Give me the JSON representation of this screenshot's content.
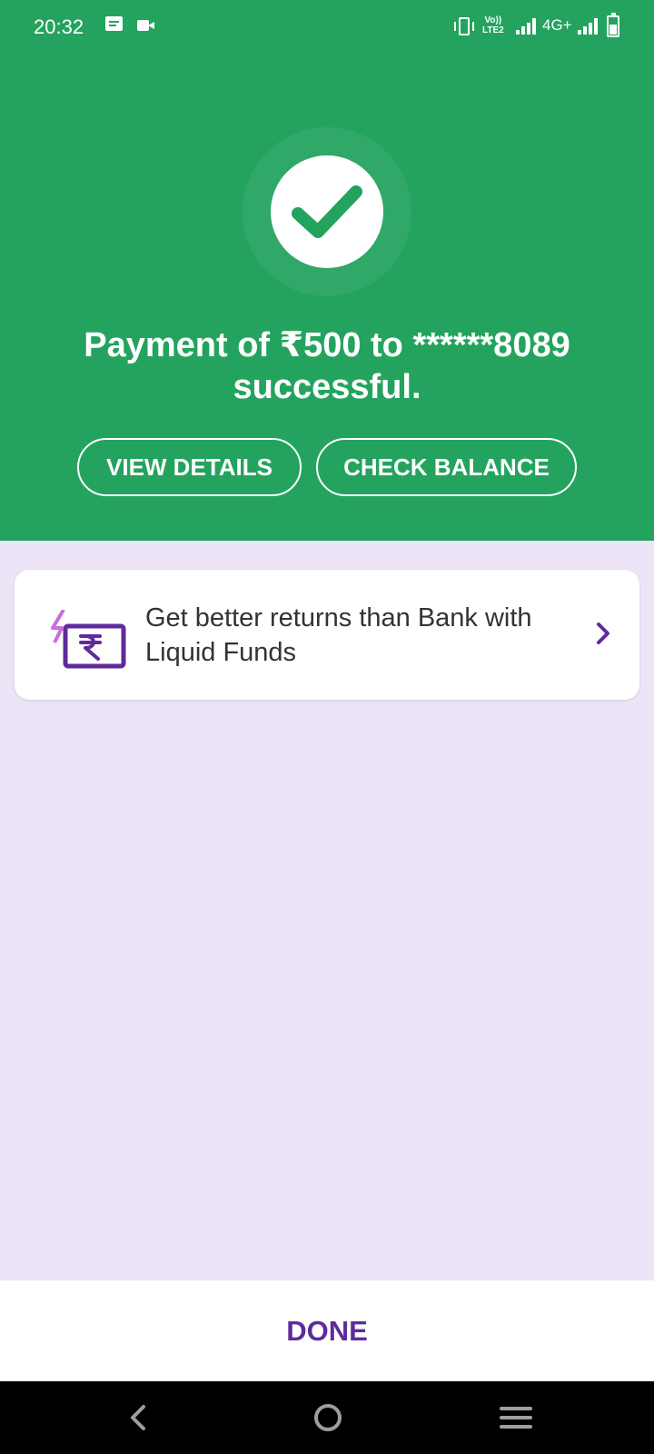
{
  "status_bar": {
    "time": "20:32",
    "volte_top": "Vo))",
    "volte_bottom": "LTE2",
    "network": "4G+",
    "icons": [
      "message-icon",
      "video-icon",
      "vibrate-icon",
      "signal-icon",
      "battery-icon"
    ]
  },
  "header": {
    "icon": "check-icon",
    "title": "Payment of ₹500 to ******8089 successful.",
    "view_details_label": "VIEW DETAILS",
    "check_balance_label": "CHECK BALANCE"
  },
  "promo": {
    "icon": "rupee-card-icon",
    "text": "Get better returns than Bank with Liquid Funds"
  },
  "footer": {
    "done_label": "DONE"
  },
  "nav_bar": {
    "icons": [
      "back-icon",
      "home-icon",
      "menu-icon"
    ]
  },
  "colors": {
    "header_bg": "#24a35f",
    "page_bg": "#ede5f7",
    "accent": "#5f2b9a"
  }
}
